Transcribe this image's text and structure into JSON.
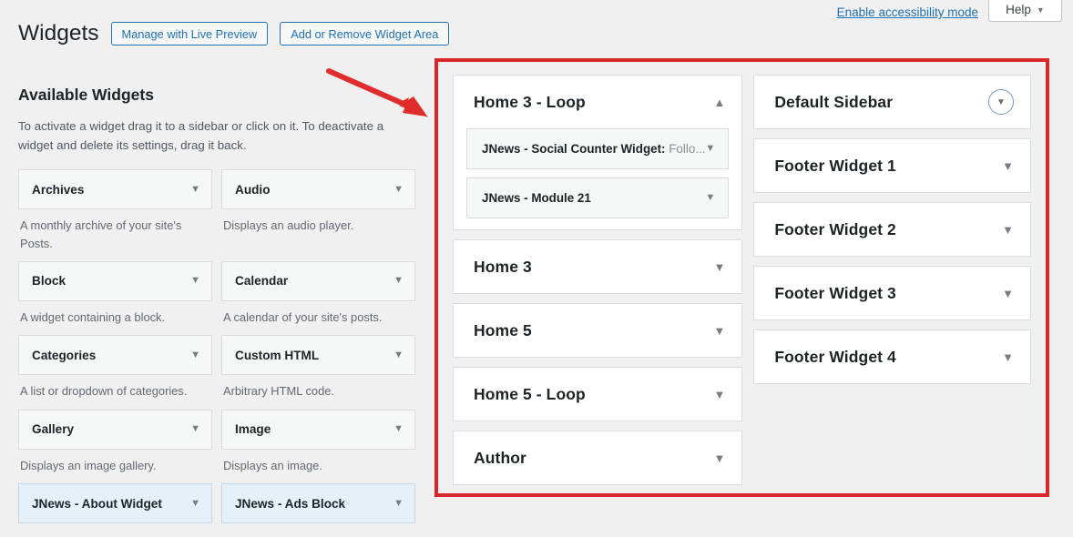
{
  "topbar": {
    "accessibility_link": "Enable accessibility mode",
    "help_label": "Help",
    "help_caret": "▼"
  },
  "header": {
    "title": "Widgets",
    "buttons": [
      {
        "label": "Manage with Live Preview"
      },
      {
        "label": "Add or Remove Widget Area"
      }
    ]
  },
  "available": {
    "heading": "Available Widgets",
    "description": "To activate a widget drag it to a sidebar or click on it. To deactivate a widget and delete its settings, drag it back.",
    "caret": "▼",
    "widgets": [
      {
        "name": "Archives",
        "desc": "A monthly archive of your site's Posts.",
        "highlight": false
      },
      {
        "name": "Audio",
        "desc": "Displays an audio player.",
        "highlight": false
      },
      {
        "name": "Block",
        "desc": "A widget containing a block.",
        "highlight": false
      },
      {
        "name": "Calendar",
        "desc": "A calendar of your site's posts.",
        "highlight": false
      },
      {
        "name": "Categories",
        "desc": "A list or dropdown of categories.",
        "highlight": false
      },
      {
        "name": "Custom HTML",
        "desc": "Arbitrary HTML code.",
        "highlight": false
      },
      {
        "name": "Gallery",
        "desc": "Displays an image gallery.",
        "highlight": false
      },
      {
        "name": "Image",
        "desc": "Displays an image.",
        "highlight": false
      },
      {
        "name": "JNews - About Widget",
        "desc": "",
        "highlight": true
      },
      {
        "name": "JNews - Ads Block",
        "desc": "",
        "highlight": true
      }
    ]
  },
  "sidebars": {
    "caret_collapsed": "▼",
    "caret_expanded": "▲",
    "left_column": [
      {
        "title": "Home 3 - Loop",
        "expanded": true,
        "widgets": [
          {
            "label": "JNews - Social Counter Widget:",
            "suffix": " Follo..."
          },
          {
            "label": "JNews - Module 21",
            "suffix": ""
          }
        ]
      },
      {
        "title": "Home 3",
        "expanded": false,
        "widgets": []
      },
      {
        "title": "Home 5",
        "expanded": false,
        "widgets": []
      },
      {
        "title": "Home 5 - Loop",
        "expanded": false,
        "widgets": []
      },
      {
        "title": "Author",
        "expanded": false,
        "widgets": []
      }
    ],
    "right_column": [
      {
        "title": "Default Sidebar",
        "expanded": false,
        "circle_toggle": true,
        "widgets": []
      },
      {
        "title": "Footer Widget 1",
        "expanded": false,
        "circle_toggle": false,
        "widgets": []
      },
      {
        "title": "Footer Widget 2",
        "expanded": false,
        "circle_toggle": false,
        "widgets": []
      },
      {
        "title": "Footer Widget 3",
        "expanded": false,
        "circle_toggle": false,
        "widgets": []
      },
      {
        "title": "Footer Widget 4",
        "expanded": false,
        "circle_toggle": false,
        "widgets": []
      }
    ]
  },
  "annotations": {
    "highlight_box_color": "#d62828",
    "arrow_color": "#e02c2c"
  }
}
